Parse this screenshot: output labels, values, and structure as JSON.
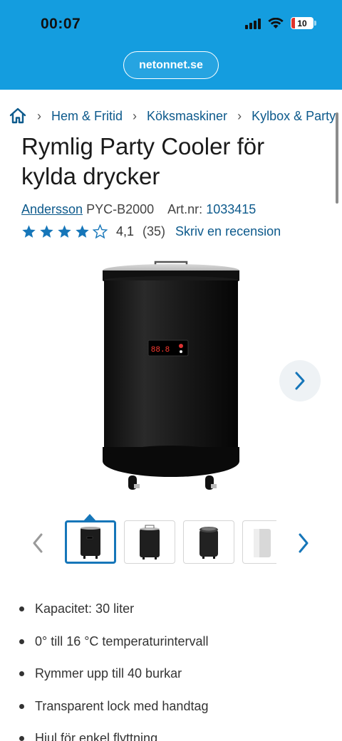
{
  "status_bar": {
    "time": "00:07",
    "battery": "10"
  },
  "browser": {
    "url": "netonnet.se"
  },
  "breadcrumb": {
    "home_icon": "home-icon",
    "items": [
      "Hem & Fritid",
      "Köksmaskiner",
      "Kylbox & Party"
    ]
  },
  "product": {
    "title": "Rymlig Party Cooler för kylda drycker",
    "brand": "Andersson",
    "model": "PYC-B2000",
    "artnr_label": "Art.nr:",
    "artnr": "1033415",
    "rating": {
      "stars_filled": 4,
      "stars_total": 5,
      "value": "4,1",
      "count": "(35)",
      "review_link": "Skriv en recension"
    },
    "display_readout": "88.8"
  },
  "gallery": {
    "next_icon": "chevron-right-icon",
    "prev_icon": "chevron-left-icon",
    "thumbnails_count": 4,
    "active_index": 0
  },
  "features": [
    "Kapacitet: 30 liter",
    "0° till 16 °C temperaturintervall",
    "Rymmer upp till 40 burkar",
    "Transparent lock med handtag",
    "Hjul för enkel flyttning"
  ],
  "colors": {
    "brand_blue": "#149ddf",
    "link_blue": "#0d5a8c",
    "accent_blue": "#1676b9"
  }
}
